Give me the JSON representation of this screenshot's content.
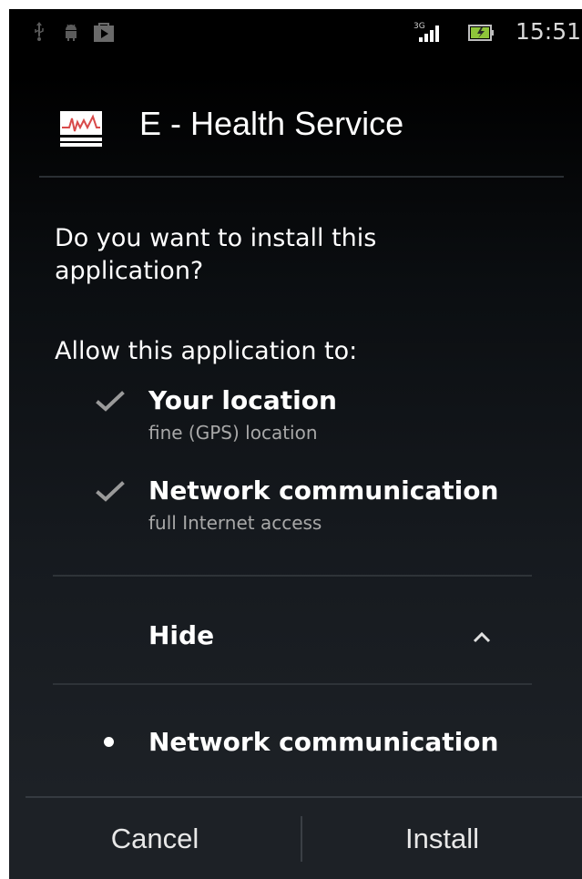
{
  "status_bar": {
    "time": "15:51",
    "network_type": "3G",
    "icons": [
      "usb-icon",
      "android-icon",
      "store-icon",
      "signal-icon",
      "battery-icon"
    ]
  },
  "header": {
    "app_name": "E - Health Service",
    "app_icon": "ecg-monitor-icon"
  },
  "prompt": {
    "question": "Do you want to install this application?",
    "allow_label": "Allow this application to:"
  },
  "permissions": [
    {
      "title": "Your location",
      "detail": "fine (GPS) location",
      "icon": "check-icon"
    },
    {
      "title": "Network communication",
      "detail": "full Internet access",
      "icon": "check-icon"
    }
  ],
  "expander": {
    "label": "Hide",
    "icon": "chevron-up-icon"
  },
  "more_permissions": [
    {
      "title": "Network communication",
      "icon": "bullet-icon"
    }
  ],
  "buttons": {
    "cancel": "Cancel",
    "install": "Install"
  },
  "colors": {
    "background": "#000000",
    "text_primary": "#ffffff",
    "text_secondary": "#a8a8a8",
    "divider": "#2e3338"
  }
}
